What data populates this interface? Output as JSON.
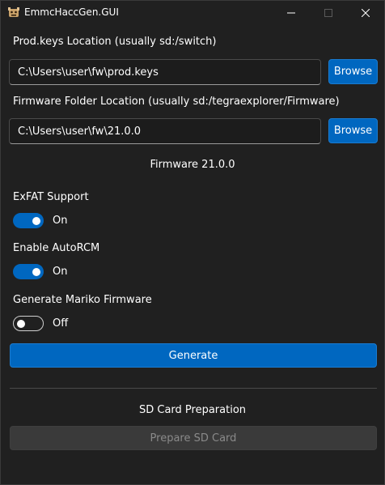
{
  "window": {
    "title": "EmmcHaccGen.GUI",
    "icon": "app-logo-icon"
  },
  "prod_keys": {
    "label": "Prod.keys Location (usually sd:/switch)",
    "value": "C:\\Users\\user\\fw\\prod.keys",
    "browse_label": "Browse"
  },
  "firmware_folder": {
    "label": "Firmware Folder Location (usually sd:/tegraexplorer/Firmware)",
    "value": "C:\\Users\\user\\fw\\21.0.0",
    "browse_label": "Browse"
  },
  "firmware_version": "Firmware 21.0.0",
  "options": [
    {
      "label": "ExFAT Support",
      "state": "On",
      "enabled": true
    },
    {
      "label": "Enable AutoRCM",
      "state": "On",
      "enabled": true
    },
    {
      "label": "Generate Mariko Firmware",
      "state": "Off",
      "enabled": false
    }
  ],
  "generate_label": "Generate",
  "sd_card": {
    "heading": "SD Card Preparation",
    "button_label": "Prepare SD Card"
  },
  "colors": {
    "accent": "#0067c0",
    "background": "#202020",
    "disabled_button": "#3a3a3a"
  }
}
